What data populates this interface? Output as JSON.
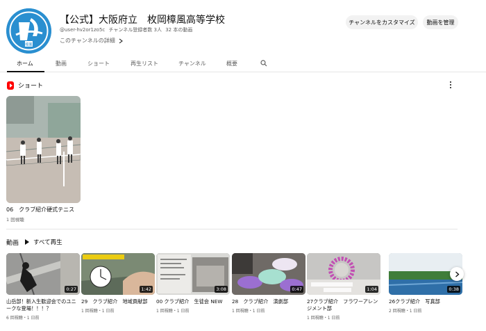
{
  "channel": {
    "title": "【公式】大阪府立　枚岡樟風高等学校",
    "handle": "@user-hv2or1zo5c",
    "subscribers": "チャンネル登録者数 3人",
    "video_count": "32 本の動画",
    "more_link": "このチャンネルの詳細",
    "avatar_text": "樟風",
    "customize_button": "チャンネルをカスタマイズ",
    "manage_button": "動画を管理"
  },
  "tabs": [
    {
      "label": "ホーム",
      "active": true
    },
    {
      "label": "動画"
    },
    {
      "label": "ショート"
    },
    {
      "label": "再生リスト"
    },
    {
      "label": "チャンネル"
    },
    {
      "label": "概要"
    }
  ],
  "shorts": {
    "heading": "ショート",
    "items": [
      {
        "title": "06　クラブ紹介硬式テニス",
        "views": "1 回視聴"
      }
    ]
  },
  "videos": {
    "heading": "動画",
    "play_all": "すべて再生",
    "items": [
      {
        "title": "山岳部！新入生歓迎会でのユニークな登場！！！？",
        "meta": "6 回視聴・1 日前",
        "duration": "0:27",
        "thumb": "climb"
      },
      {
        "title": "29　クラブ紹介　地域貢献部",
        "meta": "1 回視聴・1 日前",
        "duration": "1:42",
        "thumb": "water"
      },
      {
        "title": "00 クラブ紹介　生徒会 NEW",
        "meta": "1 回視聴・1 日前",
        "duration": "3:08",
        "thumb": "slides"
      },
      {
        "title": "28　クラブ紹介　演劇部",
        "meta": "1 回視聴・1 日前",
        "duration": "0:47",
        "thumb": "drama"
      },
      {
        "title": "27クラブ紹介　フラワーアレンジメント部",
        "meta": "1 回視聴・1 日前",
        "duration": "1:04",
        "thumb": "flower"
      },
      {
        "title": "26クラブ紹介　写真部",
        "meta": "2 回視聴・1 日前",
        "duration": "0:38",
        "thumb": "photo"
      }
    ]
  },
  "colors": {
    "shorts_red": "#ff0000",
    "avatar_blue": "#2a8fd0",
    "tab_active": "#0f0f0f",
    "secondary_text": "#606060"
  },
  "icons": [
    "search-icon",
    "chevron-right-icon",
    "shorts-icon",
    "more-vert-icon",
    "play-icon"
  ]
}
